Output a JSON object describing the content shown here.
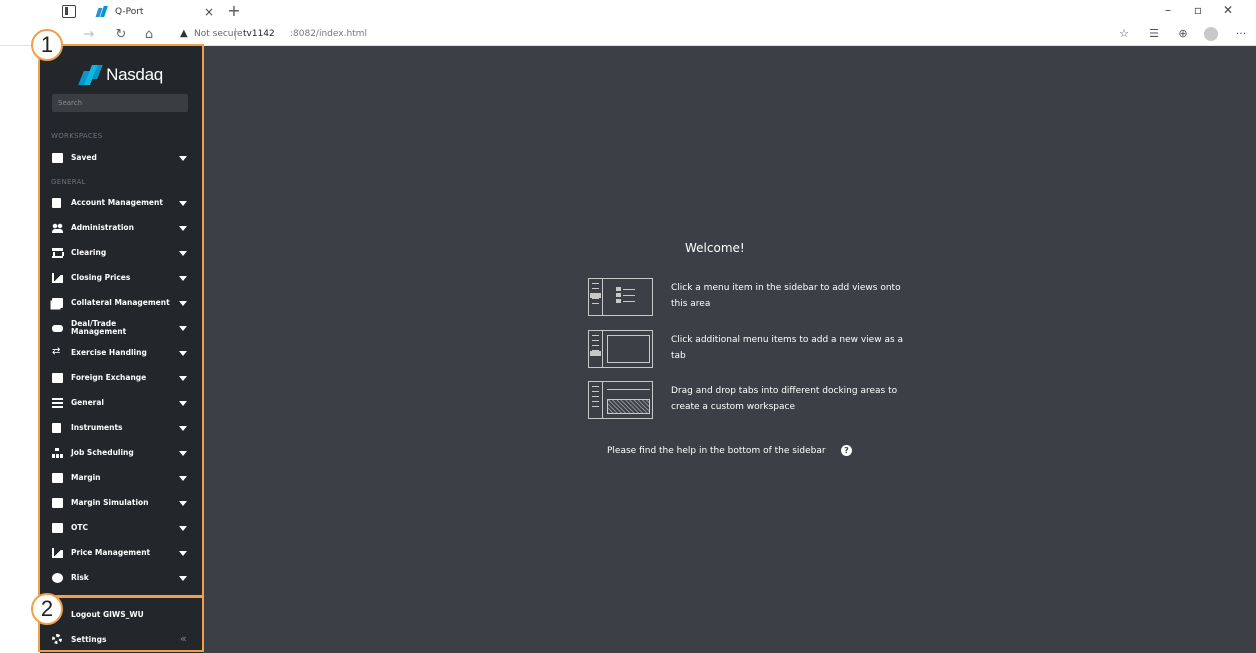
{
  "browser": {
    "tab_title": "Q-Port",
    "tab_close": "×",
    "new_tab": "+",
    "security_label": "Not secure",
    "url_host": "tv1142",
    "url_path": ":8082/index.html",
    "window_controls": [
      "–",
      "▫",
      "✕"
    ],
    "toolbar_more": "···"
  },
  "sidebar": {
    "logo_text": "Nasdaq",
    "search_placeholder": "Search",
    "sections": {
      "workspaces": "WORKSPACES",
      "general": "GENERAL"
    },
    "saved": {
      "label": "Saved",
      "icon": "save-icon"
    },
    "items": [
      {
        "label": "Account Management",
        "icon": "account-icon"
      },
      {
        "label": "Administration",
        "icon": "users-icon"
      },
      {
        "label": "Clearing",
        "icon": "bank-icon"
      },
      {
        "label": "Closing Prices",
        "icon": "area-chart-icon"
      },
      {
        "label": "Collateral Management",
        "icon": "money-icon"
      },
      {
        "label": "Deal/Trade Management",
        "icon": "handshake-icon"
      },
      {
        "label": "Exercise Handling",
        "icon": "exchange-icon"
      },
      {
        "label": "Foreign Exchange",
        "icon": "window-icon"
      },
      {
        "label": "General",
        "icon": "list-icon"
      },
      {
        "label": "Instruments",
        "icon": "file-icon"
      },
      {
        "label": "Job Scheduling",
        "icon": "sitemap-icon"
      },
      {
        "label": "Margin",
        "icon": "window-icon"
      },
      {
        "label": "Margin Simulation",
        "icon": "window-icon"
      },
      {
        "label": "OTC",
        "icon": "phone-icon"
      },
      {
        "label": "Price Management",
        "icon": "area-chart-icon"
      },
      {
        "label": "Risk",
        "icon": "gauge-icon"
      }
    ],
    "logout_label": "Logout GIWS_WU",
    "settings_label": "Settings",
    "collapse_glyph": "«"
  },
  "welcome": {
    "title": "Welcome!",
    "instructions": [
      "Click a menu item in the sidebar to add views onto this area",
      "Click additional menu items to add a new view as a tab",
      "Drag and drop tabs into different docking areas to create a custom workspace"
    ],
    "help_text": "Please find the help in the bottom of the sidebar",
    "help_glyph": "?"
  },
  "callouts": [
    "1",
    "2"
  ],
  "colors": {
    "sidebar_bg": "#23262a",
    "content_bg": "#3c3f45",
    "callout_accent": "#f0a04b",
    "logo_blue": "#12b5e0"
  }
}
